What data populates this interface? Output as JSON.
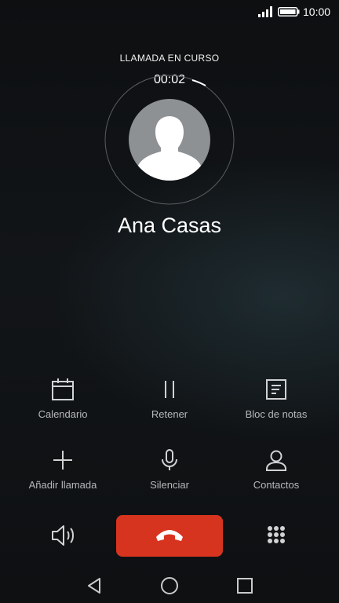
{
  "status_bar": {
    "time": "10:00"
  },
  "call": {
    "status": "LLAMADA EN CURSO",
    "timer": "00:02",
    "contact_name": "Ana Casas"
  },
  "actions": [
    {
      "label": "Calendario",
      "icon": "calendar-icon"
    },
    {
      "label": "Retener",
      "icon": "pause-icon"
    },
    {
      "label": "Bloc de notas",
      "icon": "notepad-icon"
    },
    {
      "label": "Añadir llamada",
      "icon": "plus-icon"
    },
    {
      "label": "Silenciar",
      "icon": "microphone-icon"
    },
    {
      "label": "Contactos",
      "icon": "person-icon"
    }
  ],
  "bottom_controls": {
    "speaker_icon": "speaker-icon",
    "end_call_icon": "hang-up-icon",
    "keypad_icon": "dialpad-icon",
    "end_call_color": "#d7341f"
  },
  "nav_bar": {
    "back_icon": "back-triangle-icon",
    "home_icon": "home-circle-icon",
    "recents_icon": "recents-square-icon"
  }
}
